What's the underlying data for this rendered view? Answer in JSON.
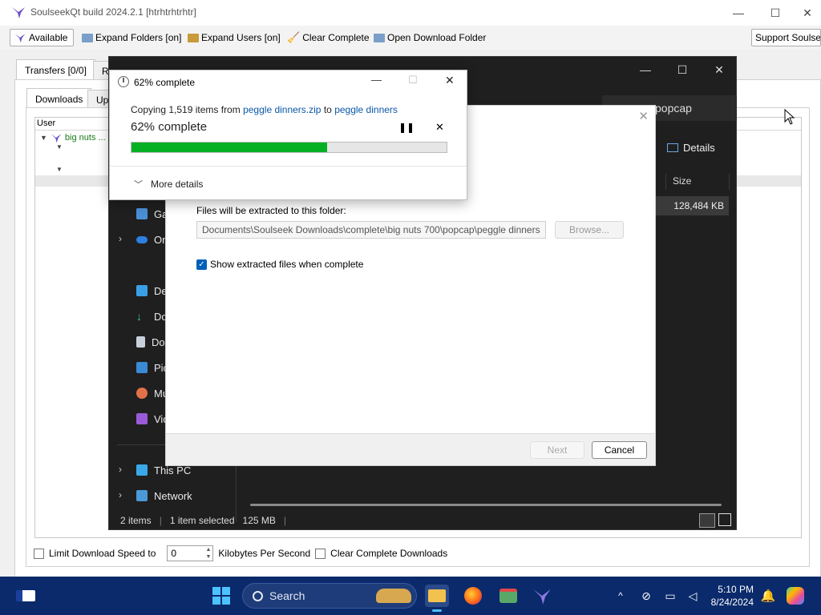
{
  "soulseek": {
    "title": "SoulseekQt build 2024.2.1 [htrhtrhtrhtr]",
    "toolbar": {
      "available": "Available",
      "expand_folders": "Expand Folders [on]",
      "expand_users": "Expand Users [on]",
      "clear_complete": "Clear Complete",
      "open_download_folder": "Open Download Folder",
      "support": "Support Soulseek"
    },
    "tabs": {
      "transfers": "Transfers [0/0]",
      "r": "R"
    },
    "subtabs": {
      "downloads": "Downloads",
      "uploads": "Upl"
    },
    "list": {
      "header_user": "User",
      "user": "big nuts ..."
    },
    "bottom": {
      "limit_label": "Limit Download Speed to",
      "limit_value": "0",
      "unit": "Kilobytes Per Second",
      "clear_label": "Clear Complete Downloads"
    }
  },
  "explorer": {
    "search_partial": "popcap",
    "details_label": "Details",
    "col_size": "Size",
    "file_size": "128,484 KB",
    "nav": [
      "Ga",
      "On",
      "De",
      "Do",
      "Do",
      "Pic",
      "Mu",
      "Vid",
      "This PC",
      "Network"
    ],
    "status": {
      "items": "2 items",
      "selected": "1 item selected",
      "size": "125 MB"
    }
  },
  "wizard": {
    "folder_label": "Files will be extracted to this folder:",
    "folder_path": "Documents\\Soulseek Downloads\\complete\\big nuts 700\\popcap\\peggle dinners",
    "browse": "Browse...",
    "show_files": "Show extracted files when complete",
    "next": "Next",
    "cancel": "Cancel"
  },
  "copy": {
    "title": "62% complete",
    "copying_prefix": "Copying 1,519 items from",
    "source": "peggle dinners.zip",
    "to_word": "to",
    "dest": "peggle dinners",
    "percent_text": "62% complete",
    "progress": 0.62,
    "more_details": "More details"
  },
  "taskbar": {
    "search_label": "Search",
    "time": "5:10 PM",
    "date": "8/24/2024"
  },
  "colors": {
    "progress_green": "#06b025",
    "link_blue": "#0b57a8",
    "taskbar_bg": "#0a2a6b",
    "explorer_bg": "#1f1f1f"
  }
}
